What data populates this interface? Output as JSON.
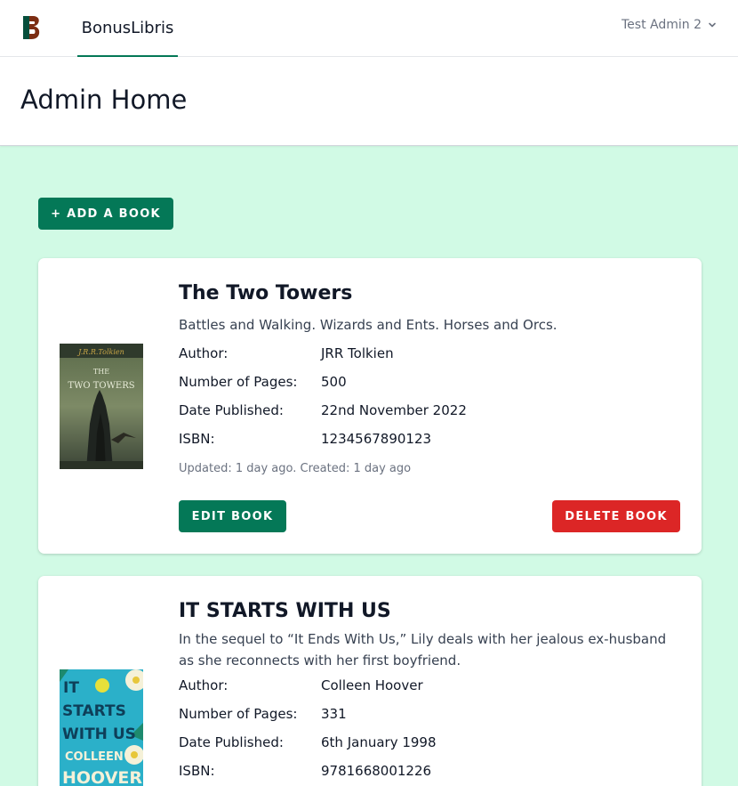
{
  "app": {
    "brand": "BonusLibris",
    "user": "Test Admin 2"
  },
  "page": {
    "title": "Admin Home"
  },
  "actions": {
    "add_book": "+ ADD A BOOK"
  },
  "labels": {
    "author": "Author:",
    "pages": "Number of Pages:",
    "published": "Date Published:",
    "isbn": "ISBN:",
    "edit": "EDIT BOOK",
    "delete": "DELETE BOOK"
  },
  "books": [
    {
      "title": "The Two Towers",
      "description": "Battles and Walking. Wizards and Ents. Horses and Orcs.",
      "author": "JRR Tolkien",
      "pages": "500",
      "published": "22nd November 2022",
      "isbn": "1234567890123",
      "meta": "Updated: 1 day ago. Created: 1 day ago",
      "cover": {
        "line1": "THE",
        "line2": "TWO TOWERS"
      }
    },
    {
      "title": "IT STARTS WITH US",
      "description": "In the sequel to “It Ends With Us,” Lily deals with her jealous ex-husband as she reconnects with her first boyfriend.",
      "author": "Colleen Hoover",
      "pages": "331",
      "published": "6th January 1998",
      "isbn": "9781668001226",
      "cover": {
        "line1": "IT",
        "line2": "STARTS",
        "line3": "WITH US",
        "line4": "COLLEEN",
        "line5": "HOOVER"
      }
    }
  ],
  "colors": {
    "primary": "#047857",
    "danger": "#dc2626",
    "background": "#d1fae5",
    "logo_dark": "#064e3b",
    "logo_brown": "#7c2d12"
  }
}
